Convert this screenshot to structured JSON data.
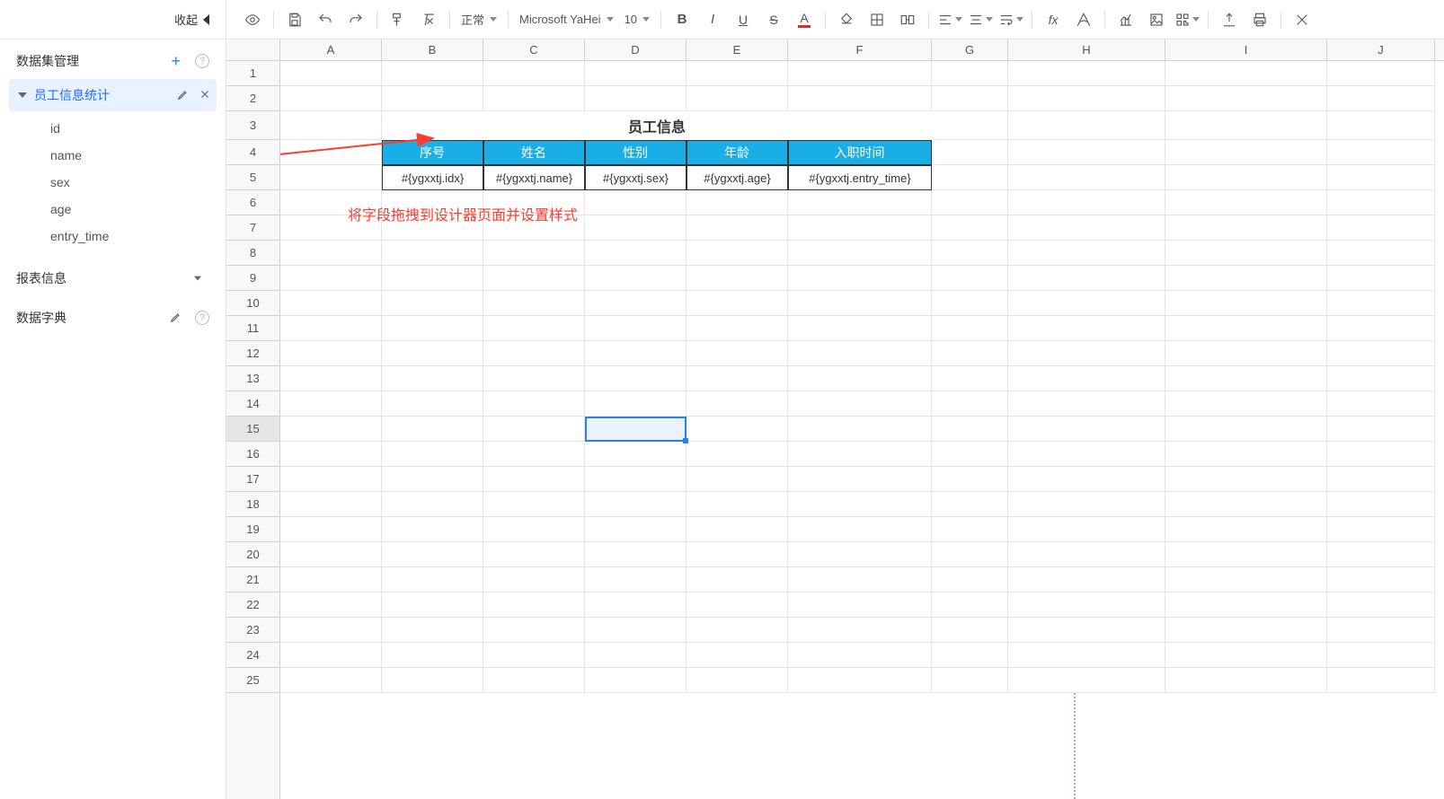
{
  "sidebar": {
    "collapse_label": "收起",
    "dataset_section": "数据集管理",
    "dataset_name": "员工信息统计",
    "fields": [
      "id",
      "name",
      "sex",
      "age",
      "entry_time"
    ],
    "report_section": "报表信息",
    "dict_section": "数据字典"
  },
  "toolbar": {
    "style_label": "正常",
    "font_label": "Microsoft YaHei",
    "size_label": "10"
  },
  "sheet": {
    "columns": [
      "A",
      "B",
      "C",
      "D",
      "E",
      "F",
      "G",
      "H",
      "I",
      "J"
    ],
    "row_count": 25,
    "selected_row": 15,
    "title": "员工信息",
    "headers": [
      "序号",
      "姓名",
      "性别",
      "年龄",
      "入职时间"
    ],
    "bindings": [
      "#{ygxxtj.idx}",
      "#{ygxxtj.name}",
      "#{ygxxtj.sex}",
      "#{ygxxtj.age}",
      "#{ygxxtj.entry_time}"
    ],
    "annotation": "将字段拖拽到设计器页面并设置样式"
  }
}
